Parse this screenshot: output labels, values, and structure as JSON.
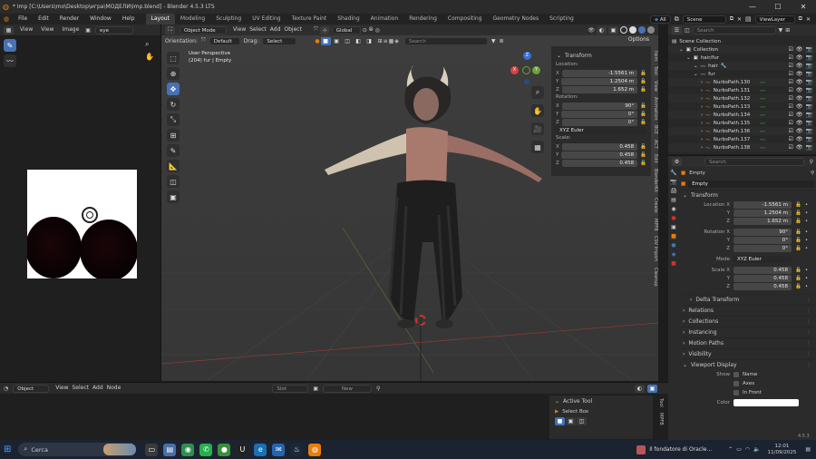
{
  "window": {
    "title": "* Imp [C:\\Users\\mo\\Desktop\\игра\\МОДЕЛИ\\Imp.blend] - Blender 4.5.3 LTS",
    "controls": [
      "—",
      "☐",
      "✕"
    ]
  },
  "menus": [
    "File",
    "Edit",
    "Render",
    "Window",
    "Help"
  ],
  "workspaces": [
    "Layout",
    "Modeling",
    "Sculpting",
    "UV Editing",
    "Texture Paint",
    "Shading",
    "Animation",
    "Rendering",
    "Compositing",
    "Geometry Nodes",
    "Scripting"
  ],
  "active_workspace": "Layout",
  "scene": {
    "all_label": "All",
    "scene_name": "Scene",
    "view_layer": "ViewLayer"
  },
  "image_editor": {
    "view": "View",
    "view2": "View",
    "image": "Image",
    "image_name": "eye"
  },
  "viewport": {
    "mode": "Object Mode",
    "menus": [
      "View",
      "Select",
      "Add",
      "Object"
    ],
    "orientation_label": "Orientation:",
    "orientation": "Default",
    "drag_label": "Drag:",
    "drag": "Select Box",
    "transform_orientation": "Global",
    "search_placeholder": "Search",
    "options": "Options",
    "overlay_title": "User Perspective",
    "overlay_sub": "(204) fur | Empty",
    "gizmo_x": "X",
    "gizmo_y": "Y",
    "gizmo_z": "Z",
    "side_tabs": [
      "Item",
      "Tool",
      "View",
      "Animation",
      "BCE",
      "ACT",
      "Edit",
      "BlenderKit",
      "Create",
      "MPFB",
      "CSV Import",
      "Cleanup"
    ]
  },
  "n_panel": {
    "header": "Transform",
    "location_label": "Location:",
    "location": [
      {
        "axis": "X",
        "value": "-1.5561 m"
      },
      {
        "axis": "Y",
        "value": "1.2504 m"
      },
      {
        "axis": "Z",
        "value": "1.652 m"
      }
    ],
    "rotation_label": "Rotation:",
    "rotation": [
      {
        "axis": "X",
        "value": "90°"
      },
      {
        "axis": "Y",
        "value": "0°"
      },
      {
        "axis": "Z",
        "value": "0°"
      }
    ],
    "rotation_mode": "XYZ Euler",
    "scale_label": "Scale:",
    "scale": [
      {
        "axis": "X",
        "value": "0.458"
      },
      {
        "axis": "Y",
        "value": "0.458"
      },
      {
        "axis": "Z",
        "value": "0.458"
      }
    ]
  },
  "outliner": {
    "search_placeholder": "Search",
    "items": [
      {
        "name": "Scene Collection",
        "depth": 0,
        "icon": "scene-collection-icon"
      },
      {
        "name": "Collection",
        "depth": 1,
        "icon": "collection-icon"
      },
      {
        "name": "hair/fur",
        "depth": 2,
        "icon": "collection-icon"
      },
      {
        "name": "hair",
        "depth": 3,
        "icon": "hair-icon"
      },
      {
        "name": "fur",
        "depth": 3,
        "icon": "hair-icon"
      },
      {
        "name": "NurbsPath.130",
        "depth": 4,
        "icon": "curve-icon"
      },
      {
        "name": "NurbsPath.131",
        "depth": 4,
        "icon": "curve-icon"
      },
      {
        "name": "NurbsPath.132",
        "depth": 4,
        "icon": "curve-icon"
      },
      {
        "name": "NurbsPath.133",
        "depth": 4,
        "icon": "curve-icon"
      },
      {
        "name": "NurbsPath.134",
        "depth": 4,
        "icon": "curve-icon"
      },
      {
        "name": "NurbsPath.135",
        "depth": 4,
        "icon": "curve-icon"
      },
      {
        "name": "NurbsPath.136",
        "depth": 4,
        "icon": "curve-icon"
      },
      {
        "name": "NurbsPath.137",
        "depth": 4,
        "icon": "curve-icon"
      },
      {
        "name": "NurbsPath.138",
        "depth": 4,
        "icon": "curve-icon"
      }
    ]
  },
  "properties": {
    "search_placeholder": "Search",
    "object_name": "Empty",
    "data_name": "Empty",
    "transform_header": "Transform",
    "location": [
      {
        "label": "Location X",
        "value": "-1.5561 m"
      },
      {
        "label": "Y",
        "value": "1.2504 m"
      },
      {
        "label": "Z",
        "value": "1.652 m"
      }
    ],
    "rotation": [
      {
        "label": "Rotation X",
        "value": "90°"
      },
      {
        "label": "Y",
        "value": "0°"
      },
      {
        "label": "Z",
        "value": "0°"
      }
    ],
    "mode_label": "Mode",
    "mode_value": "XYZ Euler",
    "scale": [
      {
        "label": "Scale X",
        "value": "0.458"
      },
      {
        "label": "Y",
        "value": "0.458"
      },
      {
        "label": "Z",
        "value": "0.458"
      }
    ],
    "sections": [
      "Delta Transform",
      "Relations",
      "Collections",
      "Instancing",
      "Motion Paths",
      "Visibility",
      "Viewport Display"
    ],
    "show_label": "Show",
    "show_options": [
      "Name",
      "Axes",
      "In Front"
    ],
    "color_label": "Color",
    "color_value": "#ffffff"
  },
  "timeline": {
    "editor": "Object",
    "menus": [
      "View",
      "Select",
      "Add",
      "Node"
    ],
    "start_label": "Slot",
    "new_label": "New",
    "active_tool_header": "Active Tool",
    "active_tool": "Select Box",
    "side_tabs": [
      "Tool",
      "MPFB"
    ]
  },
  "version": "4.5.3",
  "taskbar": {
    "search": "Cerca",
    "news": "Il fondatore di Oracle...",
    "time": "12:01",
    "date": "11/09/2025",
    "apps": [
      {
        "icon": "task-view-icon",
        "glyph": "▭",
        "color": "#3a3a3a"
      },
      {
        "icon": "files-icon",
        "glyph": "▤",
        "color": "#4a6fa5"
      },
      {
        "icon": "chrome-icon",
        "glyph": "◉",
        "color": "#2f8f4e"
      },
      {
        "icon": "whatsapp-icon",
        "glyph": "✆",
        "color": "#25b04d"
      },
      {
        "icon": "chat-icon",
        "glyph": "●",
        "color": "#3b8f3b"
      },
      {
        "icon": "unreal-icon",
        "glyph": "U",
        "color": "#222222"
      },
      {
        "icon": "edge-icon",
        "glyph": "e",
        "color": "#1b6fb5"
      },
      {
        "icon": "mail-icon",
        "glyph": "✉",
        "color": "#2565b0"
      },
      {
        "icon": "steam-icon",
        "glyph": "♨",
        "color": "#1b2838"
      },
      {
        "icon": "blender-icon",
        "glyph": "◍",
        "color": "#e87d0d"
      }
    ]
  },
  "colors": {
    "accent": "#4772b3",
    "active_orange": "#e87d0d",
    "panel": "#303030",
    "viewport": "#3d3d3d"
  }
}
